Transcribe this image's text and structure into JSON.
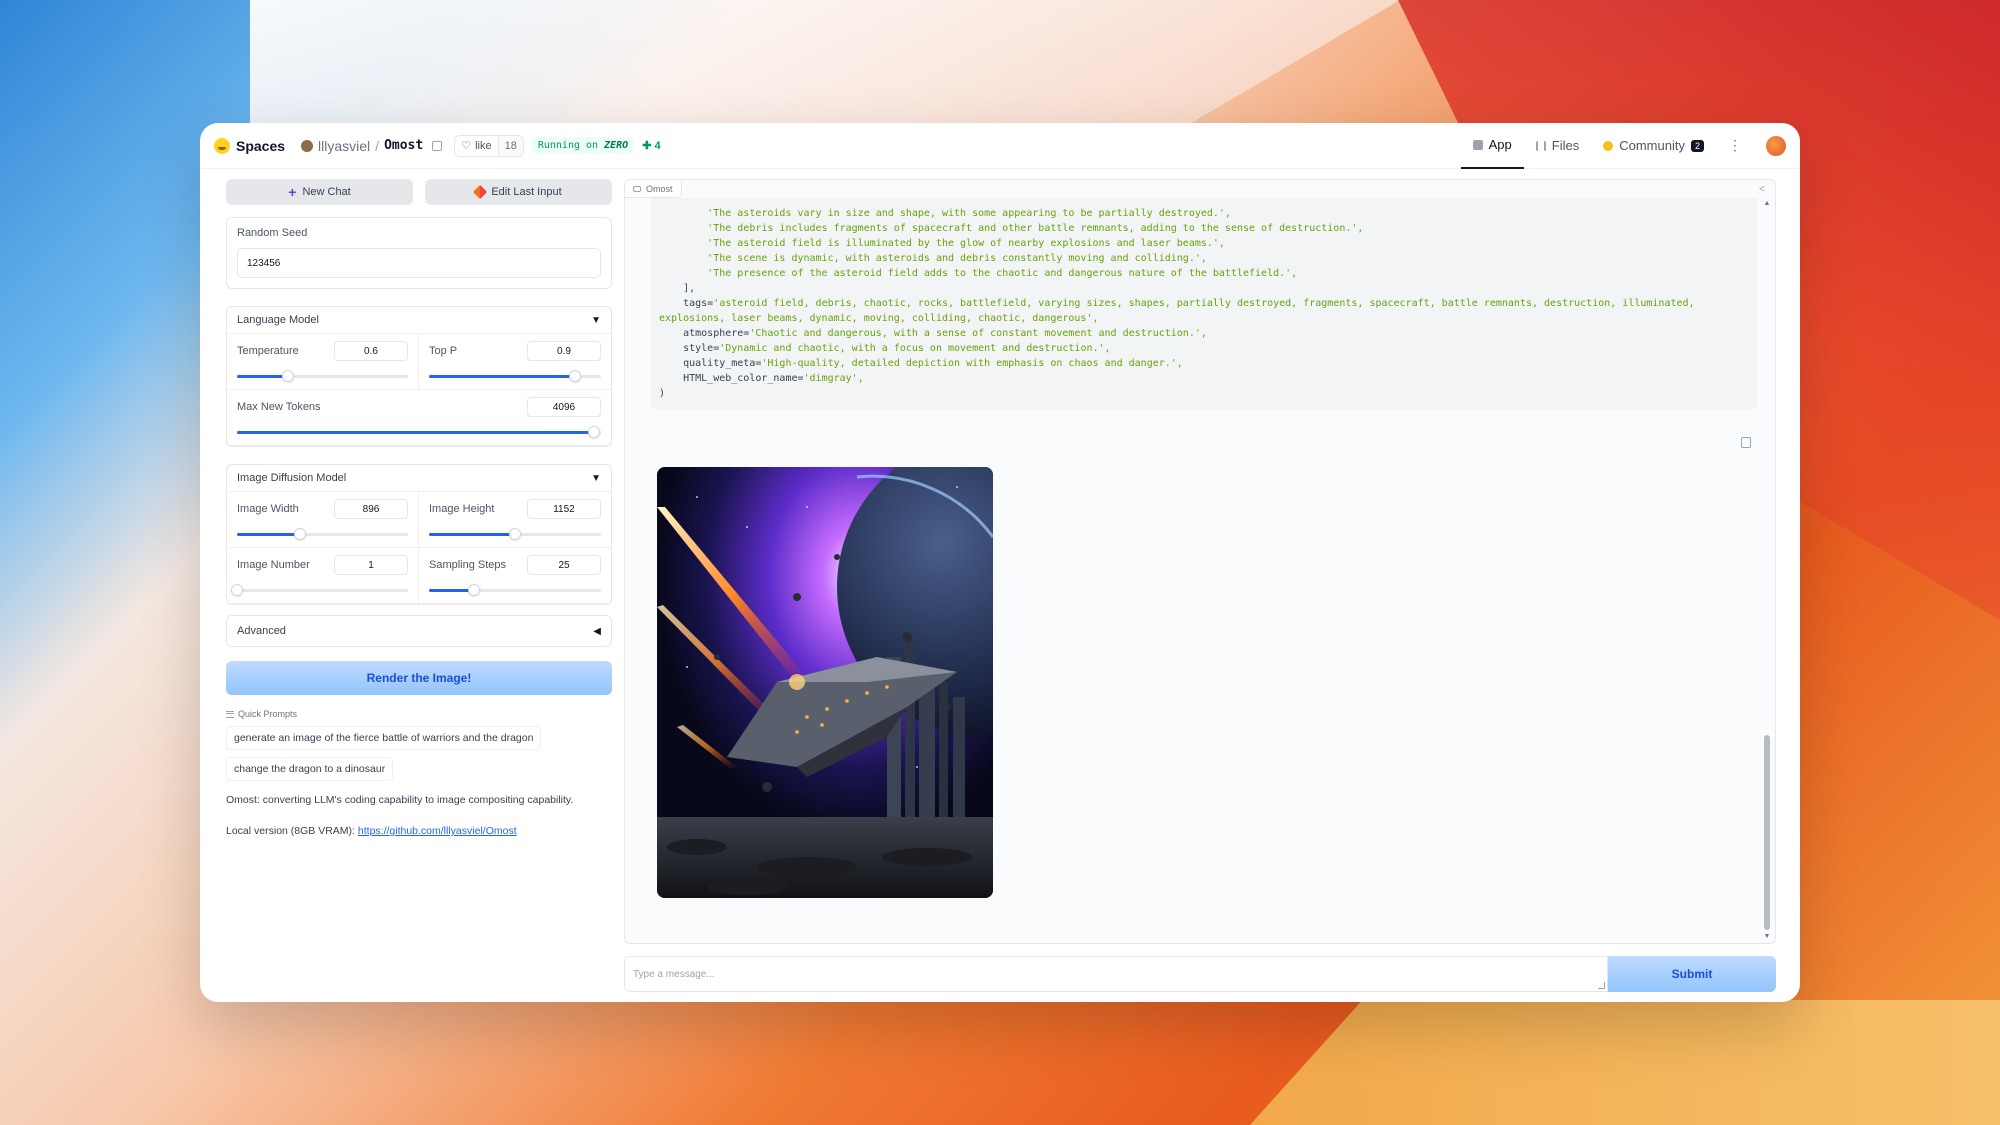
{
  "header": {
    "brand": "Spaces",
    "owner": "lllyasviel",
    "separator": "/",
    "repo": "Omost",
    "like_label": "like",
    "like_count": "18",
    "running_prefix": "Running on",
    "running_hardware": "ZERO",
    "plus_count": "4",
    "tabs": [
      {
        "label": "App",
        "icon": "app-icon",
        "active": true
      },
      {
        "label": "Files",
        "icon": "files-icon",
        "active": false
      },
      {
        "label": "Community",
        "icon": "community-icon",
        "badge": "2",
        "active": false
      }
    ]
  },
  "left": {
    "new_chat": "New Chat",
    "edit_last": "Edit Last Input",
    "seed_label": "Random Seed",
    "seed_value": "123456",
    "lm_title": "Language Model",
    "temperature": {
      "label": "Temperature",
      "value": "0.6",
      "fraction": 0.3
    },
    "top_p": {
      "label": "Top P",
      "value": "0.9",
      "fraction": 0.85
    },
    "max_tokens": {
      "label": "Max New Tokens",
      "value": "4096",
      "fraction": 0.98
    },
    "diff_title": "Image Diffusion Model",
    "image_width": {
      "label": "Image Width",
      "value": "896",
      "fraction": 0.37
    },
    "image_height": {
      "label": "Image Height",
      "value": "1152",
      "fraction": 0.5
    },
    "image_number": {
      "label": "Image Number",
      "value": "1",
      "fraction": 0.0
    },
    "sampling_steps": {
      "label": "Sampling Steps",
      "value": "25",
      "fraction": 0.26
    },
    "advanced": "Advanced",
    "render": "Render the Image!",
    "quick_prompts_title": "Quick Prompts",
    "quick_prompts": [
      "generate an image of the fierce battle of warriors and the dragon",
      "change the dragon to a dinosaur"
    ],
    "description": "Omost: converting LLM's coding capability to image compositing capability.",
    "local_prefix": "Local version (8GB VRAM): ",
    "local_link": "https://github.com/lllyasviel/Omost"
  },
  "chat": {
    "label": "Omost",
    "code_lines": [
      {
        "indent": "        ",
        "text": "'The asteroids vary in size and shape, with some appearing to be partially destroyed.',",
        "str": true
      },
      {
        "indent": "        ",
        "text": "'The debris includes fragments of spacecraft and other battle remnants, adding to the sense of destruction.',",
        "str": true
      },
      {
        "indent": "        ",
        "text": "'The asteroid field is illuminated by the glow of nearby explosions and laser beams.',",
        "str": true
      },
      {
        "indent": "        ",
        "text": "'The scene is dynamic, with asteroids and debris constantly moving and colliding.',",
        "str": true
      },
      {
        "indent": "        ",
        "text": "'The presence of the asteroid field adds to the chaotic and dangerous nature of the battlefield.',",
        "str": true
      },
      {
        "indent": "    ",
        "text": "],",
        "str": false
      },
      {
        "indent": "    ",
        "key": "tags=",
        "text": "'asteroid field, debris, chaotic, rocks, battlefield, varying sizes, shapes, partially destroyed, fragments, spacecraft, battle remnants, destruction, illuminated,",
        "str": true
      },
      {
        "indent": "",
        "text": "explosions, laser beams, dynamic, moving, colliding, chaotic, dangerous',",
        "str": true
      },
      {
        "indent": "    ",
        "key": "atmosphere=",
        "text": "'Chaotic and dangerous, with a sense of constant movement and destruction.',",
        "str": true
      },
      {
        "indent": "    ",
        "key": "style=",
        "text": "'Dynamic and chaotic, with a focus on movement and destruction.',",
        "str": true
      },
      {
        "indent": "    ",
        "key": "quality_meta=",
        "text": "'High-quality, detailed depiction with emphasis on chaos and danger.',",
        "str": true
      },
      {
        "indent": "    ",
        "key": "HTML_web_color_name=",
        "text": "'dimgray',",
        "str": true
      },
      {
        "indent": "",
        "text": ")",
        "str": false
      }
    ],
    "placeholder": "Type a message...",
    "submit": "Submit"
  },
  "colors": {
    "accent": "#2563eb",
    "string": "#65a30d",
    "submit_bg": "#93c5fd"
  }
}
